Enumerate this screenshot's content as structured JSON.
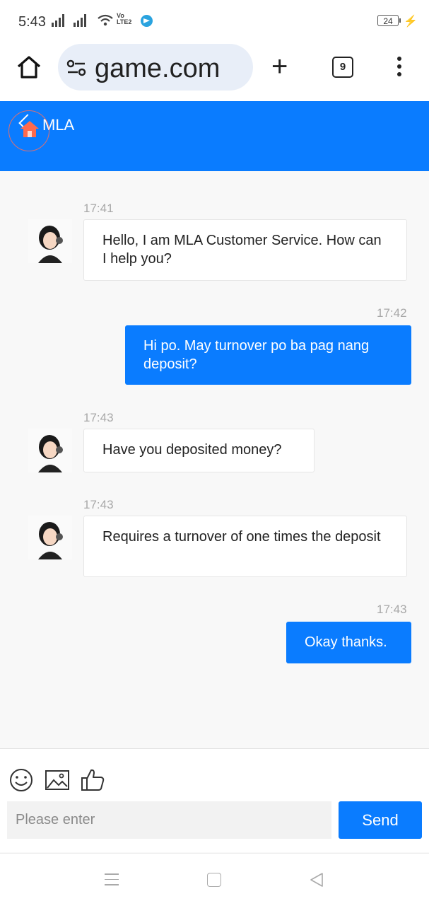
{
  "status_bar": {
    "time": "5:43",
    "network_badge": "Vo\nLTE2",
    "battery": "24"
  },
  "browser": {
    "url": "game.com",
    "tab_count": "9"
  },
  "chat": {
    "title": "MLA",
    "accent_color": "#0a7cff",
    "messages": [
      {
        "direction": "incoming",
        "time": "17:41",
        "text": "Hello, I am MLA Customer Service. How can I help you?"
      },
      {
        "direction": "outgoing",
        "time": "17:42",
        "text": "Hi po. May turnover po ba pag nang deposit?"
      },
      {
        "direction": "incoming",
        "time": "17:43",
        "text": "Have you deposited money?"
      },
      {
        "direction": "incoming",
        "time": "17:43",
        "text": "Requires a turnover of one times the deposit"
      },
      {
        "direction": "outgoing",
        "time": "17:43",
        "text": "Okay thanks."
      }
    ]
  },
  "composer": {
    "placeholder": "Please enter",
    "value": "",
    "send_label": "Send",
    "tools": [
      "emoji-icon",
      "image-icon",
      "thumbs-up-icon"
    ]
  },
  "system_nav": {
    "buttons": [
      "menu-icon",
      "home-square-icon",
      "back-triangle-icon"
    ]
  }
}
